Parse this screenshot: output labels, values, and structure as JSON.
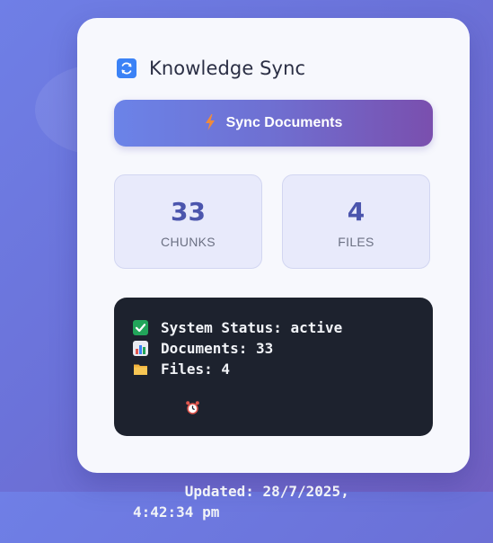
{
  "header": {
    "title": "Knowledge Sync",
    "icon": "refresh-icon"
  },
  "sync_button": {
    "label": "Sync Documents",
    "icon": "lightning-icon"
  },
  "stats": [
    {
      "value": "33",
      "label": "CHUNKS"
    },
    {
      "value": "4",
      "label": "FILES"
    }
  ],
  "console": {
    "lines": [
      {
        "icon": "check-icon",
        "text": "System Status: active"
      },
      {
        "icon": "bar-chart-icon",
        "text": "Documents: 33"
      },
      {
        "icon": "folder-icon",
        "text": "Files: 4"
      },
      {
        "icon": "alarm-clock-icon",
        "text": "Updated: 28/7/2025, 4:42:34 pm"
      }
    ]
  },
  "colors": {
    "accent": "#4b55ad",
    "button_gradient_start": "#6b83e8",
    "button_gradient_end": "#7a4fae",
    "console_bg": "#1d222e",
    "status_check": "#22a55a"
  }
}
